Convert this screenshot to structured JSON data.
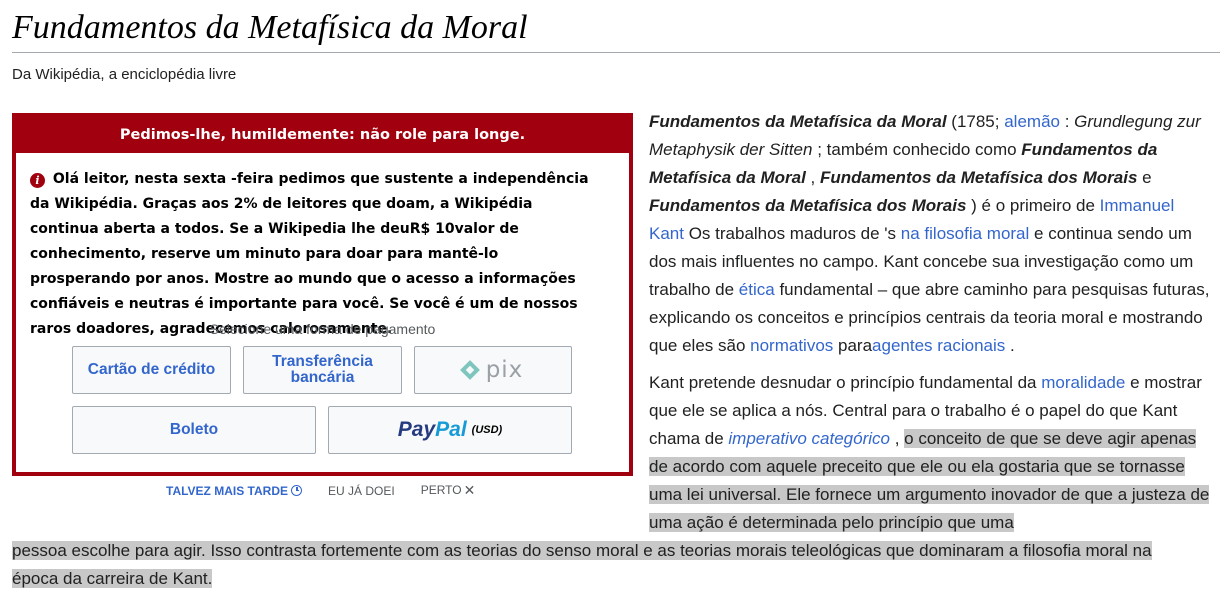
{
  "page": {
    "title": "Fundamentos da Metafísica da Moral",
    "tagline": "Da Wikipédia, a enciclopédia livre"
  },
  "banner": {
    "header": "Pedimos-lhe, humildemente: não role para longe.",
    "message": "Olá leitor, nesta sexta -feira pedimos que sustente a independência da Wikipédia. Graças aos 2% de leitores que doam, a Wikipédia continua aberta a todos. Se a Wikipedia lhe deuR$ 10valor de conhecimento, reserve um minuto para doar para mantê-lo prosperando por anos. Mostre ao mundo que o acesso a informações confiáveis e neutras é importante para você. Se você é um de nossos raros doadores, agradecemos calorosamente.",
    "select_label": "Selecione uma forma de pagamento",
    "payment": {
      "credit_card": "Cartão de crédito",
      "bank_transfer": "Transferência bancária",
      "pix": "pix",
      "boleto": "Boleto",
      "paypal_a": "Pay",
      "paypal_b": "Pal",
      "paypal_currency": "(USD)"
    },
    "links": {
      "later": "TALVEZ MAIS TARDE",
      "done": "EU JÁ DOEI",
      "close": "PERTO"
    },
    "accent_color": "#a1000e"
  },
  "article": {
    "p1": {
      "bold_title": "Fundamentos da Metafísica da Moral",
      "t1": " (1785; ",
      "link_alemao": "alemão",
      "t2": " : ",
      "german_title": "Grundlegung zur Metaphysik der Sitten",
      "t3": " ; também conhecido como ",
      "alt1": "Fundamentos da Metafísica da Moral",
      "t4": " , ",
      "alt2": "Fundamentos da Metafísica dos Morais",
      "t5": " e ",
      "alt3": "Fundamentos da Metafísica dos Morais",
      "t6": " ) é o primeiro de ",
      "link_kant": "Immanuel Kant",
      "t7": " Os trabalhos maduros de 's ",
      "link_filosofia": "na filosofia moral",
      "t8": " e continua sendo um dos mais influentes no campo. Kant concebe sua investigação como um trabalho de ",
      "link_etica": "ética",
      "t9": " fundamental – que abre caminho para pesquisas futuras, explicando os conceitos e princípios centrais da teoria moral e mostrando que eles são ",
      "link_normativos": "normativos",
      "t10": " para",
      "link_agentes": "agentes racionais",
      "t11": " ."
    },
    "p2": {
      "t1": "Kant pretende desnudar o princípio fundamental da ",
      "link_moralidade": "moralidade",
      "t2": " e mostrar que ele se aplica a nós. Central para o trabalho é o papel do que Kant chama de ",
      "link_imperativo": "imperativo categórico",
      "t3": " , ",
      "highlighted": "o conceito de que se deve agir apenas de acordo com aquele preceito que ele ou ela gostaria que se tornasse uma lei universal. Ele fornece um argumento inovador de que a justeza de uma ação é determinada pelo princípio que uma",
      "highlighted_wide": "pessoa escolhe para agir. Isso contrasta fortemente com as teorias do senso moral e as teorias morais teleológicas que dominaram a filosofia moral na época da carreira de Kant."
    }
  }
}
